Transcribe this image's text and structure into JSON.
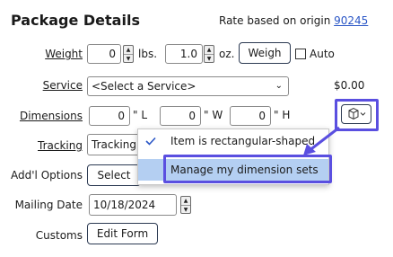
{
  "header": {
    "title": "Package Details",
    "rate_prefix": "Rate based on origin",
    "rate_zip": "90245"
  },
  "weight": {
    "label": "Weight",
    "lbs_value": "0",
    "lbs_unit": "lbs.",
    "oz_value": "1.0",
    "oz_unit": "oz.",
    "weigh_label": "Weigh",
    "auto_label": "Auto"
  },
  "service": {
    "label": "Service",
    "selected": "<Select a Service>",
    "price": "$0.00"
  },
  "dimensions": {
    "label": "Dimensions",
    "l_value": "0",
    "l_unit": "\" L",
    "w_value": "0",
    "w_unit": "\" W",
    "h_value": "0",
    "h_unit": "\" H"
  },
  "dropdown_menu": {
    "item_rect": "Item is rectangular-shaped",
    "item_manage": "Manage my dimension sets"
  },
  "tracking": {
    "label": "Tracking",
    "selected": "Tracking"
  },
  "addl": {
    "label": "Add'l Options",
    "button": "Select"
  },
  "mailing": {
    "label": "Mailing Date",
    "value": "10/18/2024"
  },
  "customs": {
    "label": "Customs",
    "button": "Edit Form"
  },
  "colors": {
    "accent_outline": "#5a4fe0",
    "menu_highlight": "#b4cff2",
    "link": "#2a56c6"
  }
}
